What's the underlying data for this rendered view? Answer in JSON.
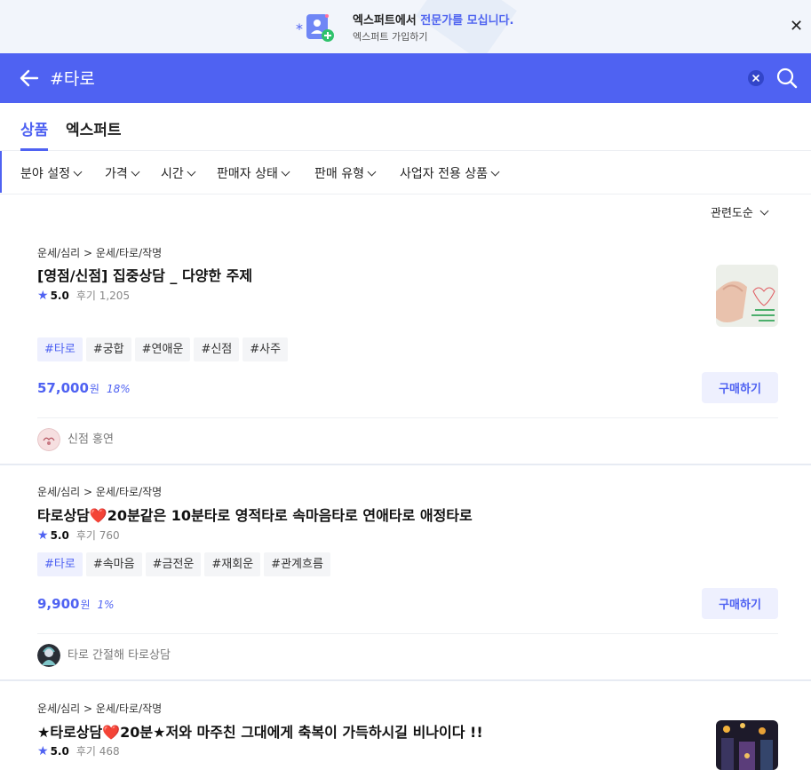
{
  "banner": {
    "title_prefix": "엑스퍼트에서 ",
    "title_highlight": "전문가를 모십니다.",
    "subtitle": "엑스퍼트 가입하기",
    "close_glyph": "✕"
  },
  "search": {
    "query": "#타로"
  },
  "tabs": [
    {
      "label": "상품",
      "active": true
    },
    {
      "label": "엑스퍼트",
      "active": false
    }
  ],
  "filters": [
    "분야 설정",
    "가격",
    "시간",
    "판매자 상태",
    "판매 유형",
    "사업자 전용 상품"
  ],
  "sort": {
    "label": "관련도순"
  },
  "products": [
    {
      "breadcrumb": "운세/심리 > 운세/타로/작명",
      "title": "[영점/신점] 집중상담 _ 다양한 주제",
      "rating": "5.0",
      "reviews": "후기 1,205",
      "tags": [
        "#타로",
        "#궁합",
        "#연애운",
        "#신점",
        "#사주"
      ],
      "price": "57,000",
      "currency": "원",
      "discount": "18%",
      "buy_label": "구매하기",
      "seller": "신점 홍연"
    },
    {
      "breadcrumb": "운세/심리 > 운세/타로/작명",
      "title": "타로상담❤️20분같은 10분타로 영적타로 속마음타로 연애타로 애정타로",
      "rating": "5.0",
      "reviews": "후기 760",
      "tags": [
        "#타로",
        "#속마음",
        "#금전운",
        "#재회운",
        "#관계흐름"
      ],
      "price": "9,900",
      "currency": "원",
      "discount": "1%",
      "buy_label": "구매하기",
      "seller": "타로 간절해 타로상담"
    },
    {
      "breadcrumb": "운세/심리 > 운세/타로/작명",
      "title": "★타로상담❤️20분★저와 마주친 그대에게 축복이 가득하시길 비나이다 !!",
      "rating": "5.0",
      "reviews": "후기 468"
    }
  ],
  "colors": {
    "accent": "#4f62f2",
    "banner_bg": "#f2f5fb",
    "tag_bg": "#f4f5f7",
    "tag_active_bg": "#eef0fe"
  }
}
